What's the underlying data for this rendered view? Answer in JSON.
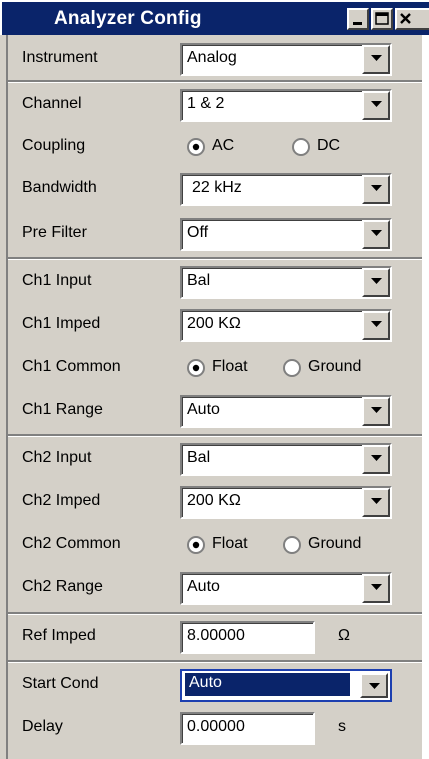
{
  "window": {
    "title": "Analyzer Config",
    "buttons": [
      "minimize-icon",
      "maximize-icon",
      "close-icon"
    ]
  },
  "colors": {
    "titlebar": "#0a246a",
    "face": "#d4d0c8",
    "selection": "#0a246a",
    "focus_border": "#1d3fb0"
  },
  "rows": {
    "instrument": {
      "label": "Instrument",
      "value": "Analog"
    },
    "channel": {
      "label": "Channel",
      "value": "1 & 2"
    },
    "coupling": {
      "label": "Coupling",
      "options": [
        "AC",
        "DC"
      ],
      "selected": "AC"
    },
    "bandwidth": {
      "label": "Bandwidth",
      "value": "22 kHz"
    },
    "pre_filter": {
      "label": "Pre Filter",
      "value": "Off"
    },
    "ch1_input": {
      "label": "Ch1 Input",
      "value": "Bal"
    },
    "ch1_imped": {
      "label": "Ch1 Imped",
      "value": "200 KΩ"
    },
    "ch1_common": {
      "label": "Ch1 Common",
      "options": [
        "Float",
        "Ground"
      ],
      "selected": "Float"
    },
    "ch1_range": {
      "label": "Ch1 Range",
      "value": "Auto"
    },
    "ch2_input": {
      "label": "Ch2 Input",
      "value": "Bal"
    },
    "ch2_imped": {
      "label": "Ch2 Imped",
      "value": "200 KΩ"
    },
    "ch2_common": {
      "label": "Ch2 Common",
      "options": [
        "Float",
        "Ground"
      ],
      "selected": "Float"
    },
    "ch2_range": {
      "label": "Ch2 Range",
      "value": "Auto"
    },
    "ref_imped": {
      "label": "Ref Imped",
      "value": "8.00000",
      "unit": "Ω"
    },
    "start_cond": {
      "label": "Start Cond",
      "value": "Auto"
    },
    "delay": {
      "label": "Delay",
      "value": "0.00000",
      "unit": "s"
    }
  }
}
